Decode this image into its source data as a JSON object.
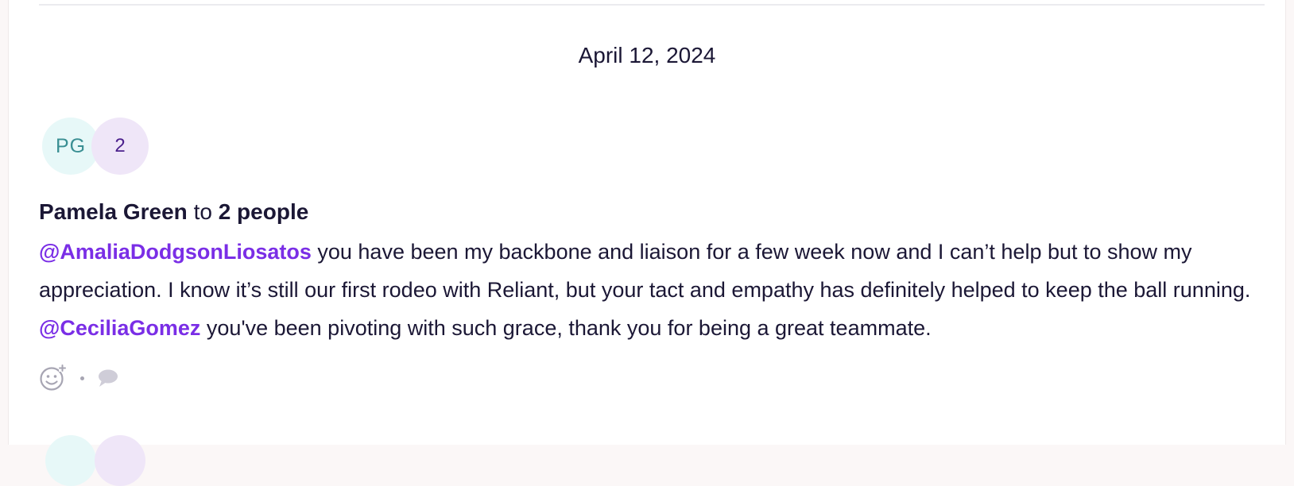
{
  "feed": {
    "date": "April 12, 2024",
    "post": {
      "sender_initials": "PG",
      "recipient_count": "2",
      "sender_name": "Pamela Green",
      "connector": "to",
      "recipients_label": "2 people",
      "message": {
        "mention1": "@AmaliaDodgsonLiosatos",
        "text1": " you have been my backbone and liaison for a few week now and I can’t help but to show my appreciation. I know it’s still our first rodeo with Reliant, but your tact and empathy has definitely helped to keep the ball running. ",
        "mention2": "@CeciliaGomez",
        "text2": " you've been pivoting with such grace, thank you for being a great teammate."
      },
      "actions": {
        "add_reaction_icon": "smiley-plus-icon",
        "comment_icon": "comment-bubble-icon"
      }
    }
  },
  "colors": {
    "mention": "#7a2ee6",
    "text": "#1b1735",
    "sender_avatar_bg": "#e7f8f8",
    "count_avatar_bg": "#efe6f8"
  }
}
